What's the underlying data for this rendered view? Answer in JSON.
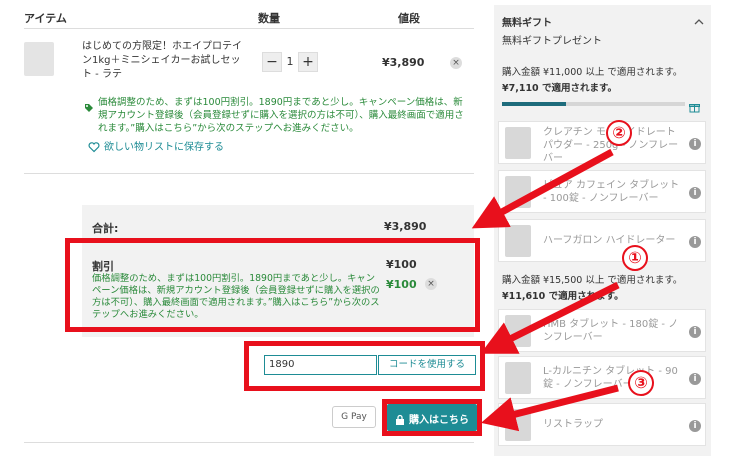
{
  "table_header": {
    "item": "アイテム",
    "quantity": "数量",
    "price": "値段"
  },
  "product": {
    "title": "はじめての方限定！ホエイプロテイン1kg＋ミニシェイカーお試しセット - ラテ",
    "quantity": "1",
    "minus": "−",
    "plus": "+",
    "price": "¥3,890",
    "remove": "×",
    "promo_text": "価格調整のため、まずは100円割引。1890円まであと少し。キャンペーン価格は、新規アカウント登録後（会員登録せずに購入を選択の方は不可）、購入最終画面で適用されます。”購入はこちら”から次のステップへお進みください。",
    "wishlist": "欲しい物リストに保存する"
  },
  "summary": {
    "subtotal_label": "合計:",
    "subtotal_value": "¥3,890",
    "discount_label": "割引",
    "discount_value": "¥100",
    "discount_text": "価格調整のため、まずは100円割引。1890円まであと少し。キャンペーン価格は、新規アカウント登録後（会員登録せずに購入を選択の方は不可）、購入最終画面で適用されます。”購入はこちら”から次のステップへお進みください。",
    "discount_green_value": "¥100",
    "remove": "×"
  },
  "coupon": {
    "value": "1890",
    "button": "コードを使用する"
  },
  "checkout": {
    "gpay": "G Pay",
    "buy": "購入はこちら"
  },
  "gift_panel": {
    "title": "無料ギフト",
    "subtitle": "無料ギフトプレゼント",
    "tier1_condition": "購入金額 ¥11,000 以上 で適用されます。",
    "tier1_remaining": "¥7,110 で適用されます。",
    "tier1_progress": 0.35,
    "tier2_condition": "購入金額 ¥15,500 以上 で適用されます。",
    "tier2_remaining": "¥11,610 で適用されます。",
    "items": [
      {
        "name": "クレアチン モノハイドレート パウダー - 250g - ノンフレーバー"
      },
      {
        "name": "ピュア カフェイン タブレット - 100錠 - ノンフレーバー"
      },
      {
        "name": "ハーフガロン ハイドレーター"
      },
      {
        "name": "HMB タブレット - 180錠 - ノンフレーバー"
      },
      {
        "name": "L-カルニチン タブレット - 90錠 - ノンフレーバー"
      },
      {
        "name": "リストラップ"
      }
    ],
    "info": "i"
  },
  "annotations": {
    "one": "①",
    "two": "②",
    "three": "③"
  },
  "colors": {
    "accent": "#1e8c95",
    "annotation_red": "#e8101c",
    "promo_green": "#2a8a3a"
  }
}
